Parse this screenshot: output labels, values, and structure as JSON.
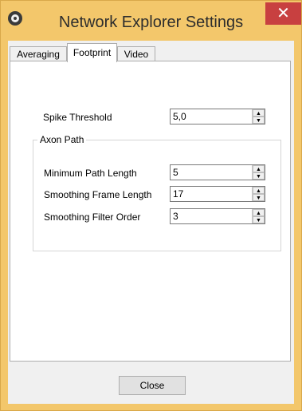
{
  "window": {
    "title": "Network Explorer Settings",
    "close_glyph": "✕"
  },
  "tabs": [
    {
      "label": "Averaging"
    },
    {
      "label": "Footprint",
      "active": true
    },
    {
      "label": "Video"
    }
  ],
  "footprint": {
    "spike_threshold": {
      "label": "Spike Threshold",
      "value": "5,0"
    },
    "axon_path": {
      "title": "Axon Path",
      "fields": [
        {
          "label": "Minimum Path Length",
          "value": "5"
        },
        {
          "label": "Smoothing Frame Length",
          "value": "17"
        },
        {
          "label": "Smoothing Filter Order",
          "value": "3"
        }
      ]
    }
  },
  "spinner": {
    "up_glyph": "▲",
    "down_glyph": "▼"
  },
  "buttons": {
    "close_label": "Close"
  }
}
